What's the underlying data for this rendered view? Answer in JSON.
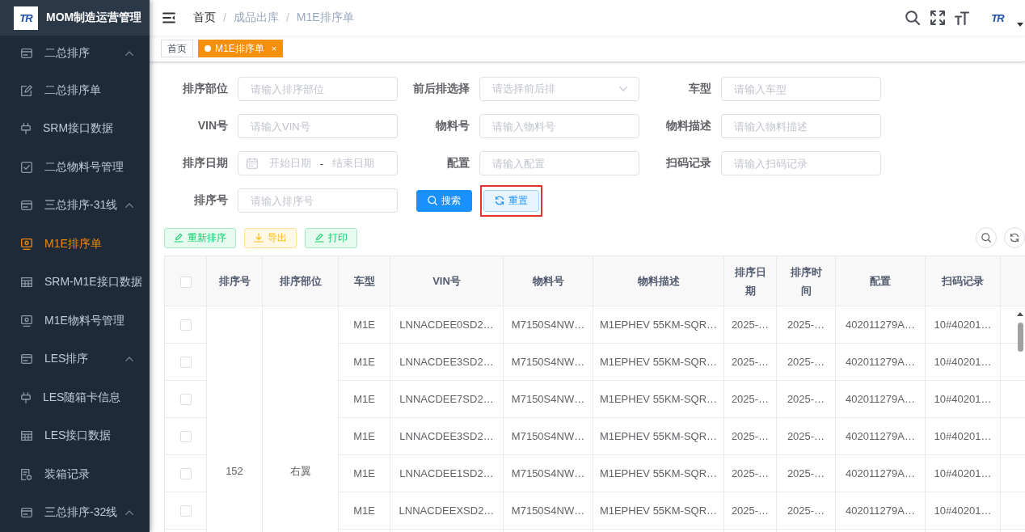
{
  "sidebar": {
    "logo_mark": "TR",
    "title": "MOM制造运营管理",
    "groups": [
      {
        "label": "二总排序",
        "expanded": true,
        "children": [
          {
            "label": "二总排序单",
            "selected": false
          },
          {
            "label": "SRM接口数据",
            "selected": false
          },
          {
            "label": "二总物料号管理",
            "selected": false
          }
        ]
      },
      {
        "label": "三总排序-31线",
        "expanded": true,
        "children": [
          {
            "label": "M1E排序单",
            "selected": true
          },
          {
            "label": "SRM-M1E接口数据",
            "selected": false
          },
          {
            "label": "M1E物料号管理",
            "selected": false
          }
        ]
      },
      {
        "label": "LES排序",
        "expanded": true,
        "children": [
          {
            "label": "LES随箱卡信息",
            "selected": false
          },
          {
            "label": "LES接口数据",
            "selected": false
          },
          {
            "label": "装箱记录",
            "selected": false
          }
        ]
      },
      {
        "label": "三总排序-32线",
        "expanded": true
      }
    ]
  },
  "header": {
    "breadcrumb": [
      {
        "label": "首页",
        "link": true
      },
      {
        "label": "成品出库",
        "link": false
      },
      {
        "label": "M1E排序单",
        "link": false
      }
    ],
    "breadcrumb_separator": "/",
    "avatar_mark": "TR"
  },
  "tags": [
    {
      "label": "首页",
      "selected": false
    },
    {
      "label": "M1E排序单",
      "selected": true,
      "close": "×"
    }
  ],
  "filters": [
    {
      "label": "排序部位",
      "kind": "text",
      "placeholder": "请输入排序部位"
    },
    {
      "label": "前后排选择",
      "kind": "select",
      "placeholder": "请选择前后排"
    },
    {
      "label": "车型",
      "kind": "text",
      "placeholder": "请输入车型"
    },
    {
      "label": "VIN号",
      "kind": "text",
      "placeholder": "请输入VIN号"
    },
    {
      "label": "物料号",
      "kind": "text",
      "placeholder": "请输入物料号"
    },
    {
      "label": "物料描述",
      "kind": "text",
      "placeholder": "请输入物料描述"
    },
    {
      "label": "排序日期",
      "kind": "daterange",
      "start_placeholder": "开始日期",
      "separator": "-",
      "end_placeholder": "结束日期"
    },
    {
      "label": "配置",
      "kind": "text",
      "placeholder": "请输入配置"
    },
    {
      "label": "扫码记录",
      "kind": "text",
      "placeholder": "请输入扫码记录"
    },
    {
      "label": "排序号",
      "kind": "text",
      "placeholder": "请输入排序号"
    }
  ],
  "filter_buttons": [
    {
      "label": "搜索",
      "kind": "search",
      "highlighted": false
    },
    {
      "label": "重置",
      "kind": "reset",
      "highlighted": true
    }
  ],
  "toolbar": [
    {
      "label": "重新排序",
      "kind": "success"
    },
    {
      "label": "导出",
      "kind": "warning"
    },
    {
      "label": "打印",
      "kind": "success"
    }
  ],
  "table": {
    "all_checked": false,
    "columns": [
      "排序号",
      "排序部位",
      "车型",
      "VIN号",
      "物料号",
      "物料描述",
      "排序日期",
      "排序时间",
      "配置",
      "扫码记录"
    ],
    "groups": [
      {
        "merged_cells": [
          "152",
          "右翼"
        ],
        "rows": [
          {
            "checked": false,
            "cells": [
              "M1E",
              "LNNACDEE0SD2…",
              "M7150S4NW…",
              "M1EPHEV 55KM-SQR…",
              "2025-…",
              "2025-…",
              "402011279A…",
              "10#40201…"
            ]
          },
          {
            "checked": false,
            "cells": [
              "M1E",
              "LNNACDEE3SD2…",
              "M7150S4NW…",
              "M1EPHEV 55KM-SQR…",
              "2025-…",
              "2025-…",
              "402011279A…",
              "10#40201…"
            ]
          },
          {
            "checked": false,
            "cells": [
              "M1E",
              "LNNACDEE7SD2…",
              "M7150S4NW…",
              "M1EPHEV 55KM-SQR…",
              "2025-…",
              "2025-…",
              "402011279A…",
              "10#40201…"
            ]
          },
          {
            "checked": false,
            "cells": [
              "M1E",
              "LNNACDEE3SD2…",
              "M7150S4NW…",
              "M1EPHEV 55KM-SQR…",
              "2025-…",
              "2025-…",
              "402011279A…",
              "10#40201…"
            ]
          },
          {
            "checked": false,
            "cells": [
              "M1E",
              "LNNACDEE1SD2…",
              "M7150S4NW…",
              "M1EPHEV 55KM-SQR…",
              "2025-…",
              "2025-…",
              "402011279A…",
              "10#40201…"
            ]
          },
          {
            "checked": false,
            "cells": [
              "M1E",
              "LNNACDEEXSD2…",
              "M7150S4NW…",
              "M1EPHEV 55KM-SQR…",
              "2025-…",
              "2025-…",
              "402011279A…",
              "10#40201…"
            ]
          }
        ]
      }
    ]
  }
}
